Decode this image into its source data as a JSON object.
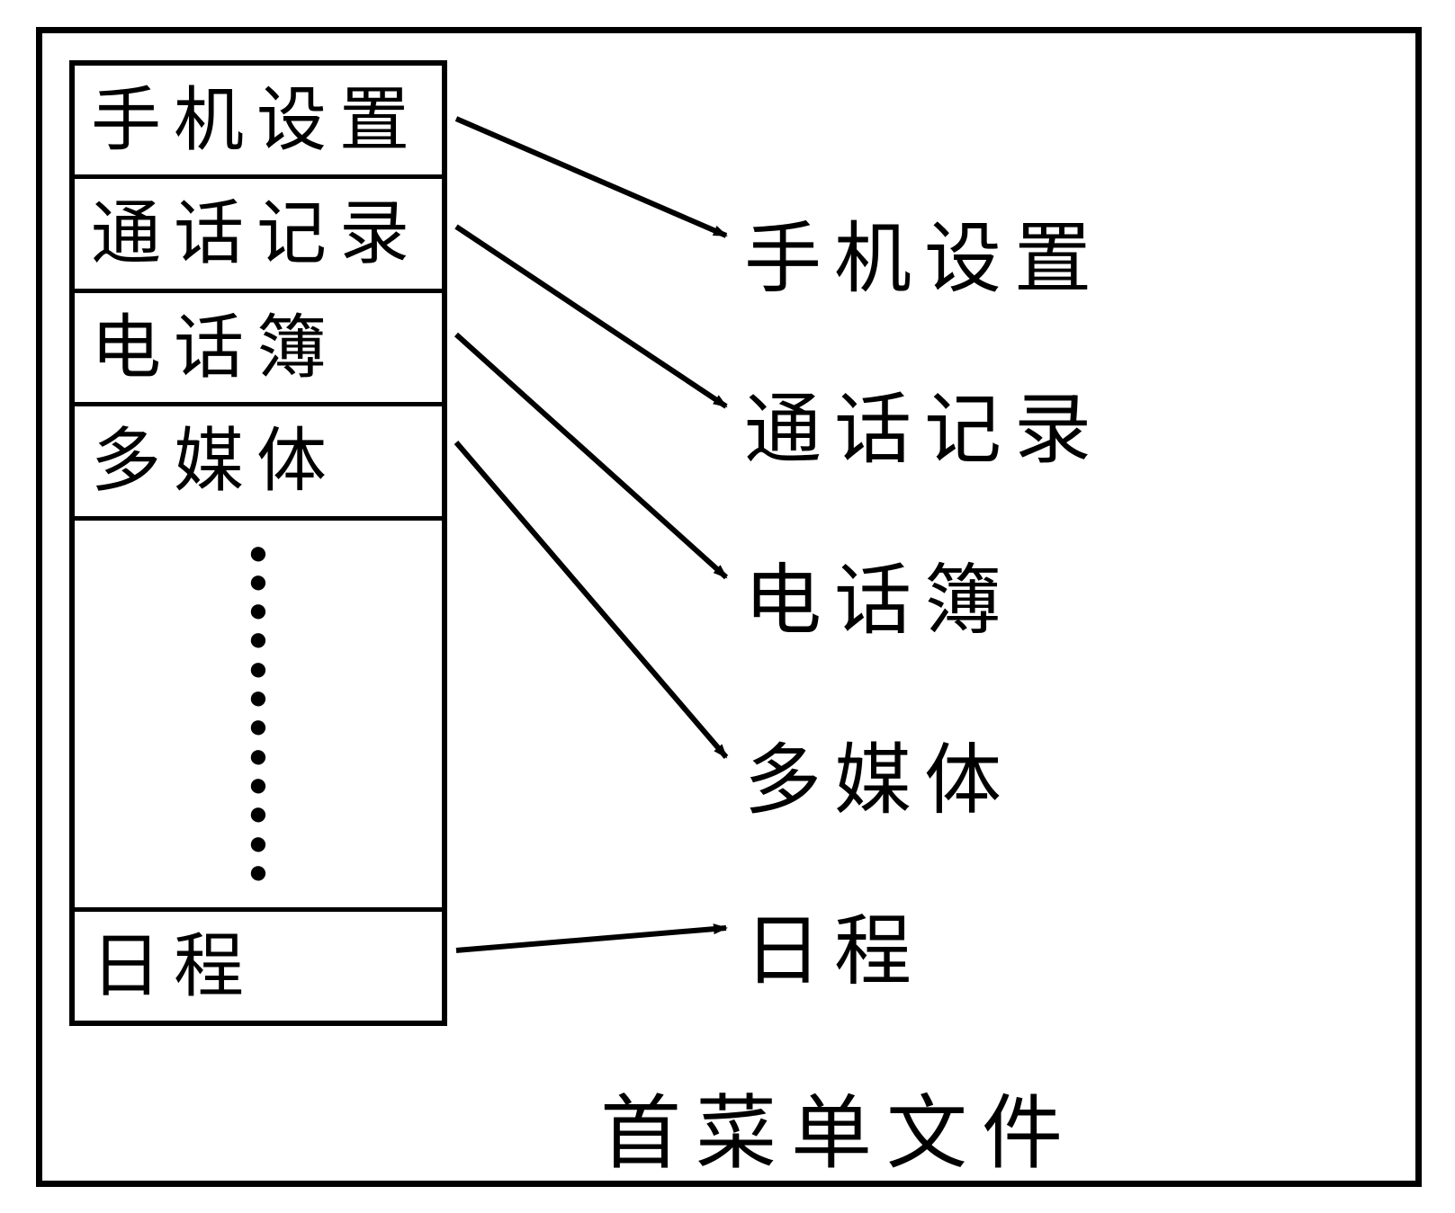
{
  "diagram": {
    "caption": "首菜单文件",
    "menu": {
      "items": [
        {
          "label": "手机设置"
        },
        {
          "label": "通话记录"
        },
        {
          "label": "电话簿"
        },
        {
          "label": "多媒体"
        },
        {
          "label": "日程"
        }
      ],
      "ellipsis_between_index": 3
    },
    "targets": [
      {
        "label": "手机设置"
      },
      {
        "label": "通话记录"
      },
      {
        "label": "电话簿"
      },
      {
        "label": "多媒体"
      },
      {
        "label": "日程"
      }
    ]
  }
}
